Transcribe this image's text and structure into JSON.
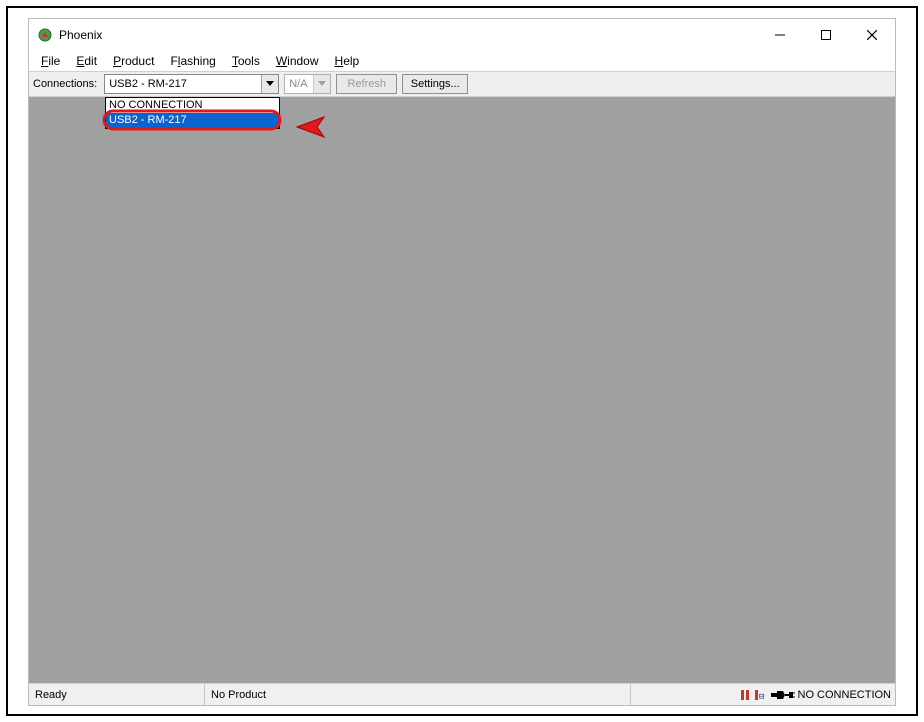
{
  "window": {
    "title": "Phoenix"
  },
  "menu": {
    "items": [
      "File",
      "Edit",
      "Product",
      "Flashing",
      "Tools",
      "Window",
      "Help"
    ]
  },
  "toolbar": {
    "connections_label": "Connections:",
    "connections_selected": "USB2 - RM-217",
    "combo2_value": "N/A",
    "refresh_label": "Refresh",
    "settings_label": "Settings..."
  },
  "dropdown": {
    "items": [
      {
        "label": "NO CONNECTION",
        "selected": false
      },
      {
        "label": "USB2 - RM-217",
        "selected": true
      }
    ]
  },
  "statusbar": {
    "state": "Ready",
    "product": "No Product",
    "connection": "NO CONNECTION"
  }
}
